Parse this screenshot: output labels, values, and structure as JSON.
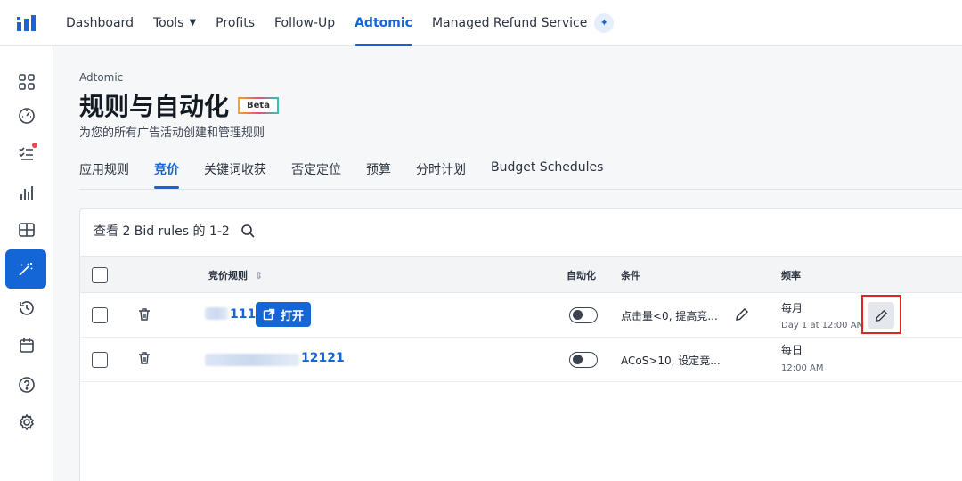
{
  "topnav": {
    "items": [
      {
        "label": "Dashboard"
      },
      {
        "label": "Tools"
      },
      {
        "label": "Profits"
      },
      {
        "label": "Follow-Up"
      },
      {
        "label": "Adtomic"
      },
      {
        "label": "Managed Refund Service"
      }
    ],
    "active": "Adtomic",
    "accent": "#1466d6"
  },
  "sidebar": {
    "icons": [
      "grid-icon",
      "gauge-icon",
      "checklist-icon",
      "bar-chart-icon",
      "table-icon",
      "magic-wand-icon",
      "history-icon",
      "calendar-icon",
      "help-icon",
      "settings-icon"
    ],
    "active": "magic-wand-icon"
  },
  "page": {
    "breadcrumb": "Adtomic",
    "title": "规则与自动化",
    "badge": "Beta",
    "subtitle": "为您的所有广告活动创建和管理规则"
  },
  "tabs": [
    "应用规则",
    "竞价",
    "关键词收获",
    "否定定位",
    "预算",
    "分时计划",
    "Budget Schedules"
  ],
  "active_tab": "竞价",
  "table": {
    "summary": "查看 2 Bid rules 的 1-2",
    "headers": {
      "rule": "竞价规则",
      "automation": "自动化",
      "condition": "条件",
      "frequency": "频率"
    },
    "rows": [
      {
        "name": "111",
        "open_label": "打开",
        "condition": "点击量<0, 提高竞...",
        "frequency": "每月",
        "frequency_detail": "Day 1 at 12:00 AM"
      },
      {
        "name": "12121",
        "condition": "ACoS>10, 设定竞...",
        "frequency": "每日",
        "frequency_detail": "12:00 AM"
      }
    ]
  }
}
